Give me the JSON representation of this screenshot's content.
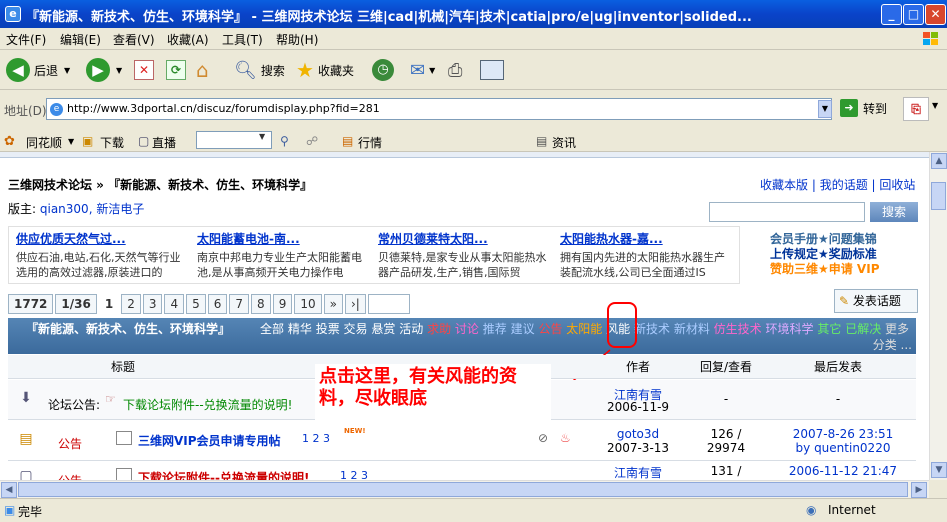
{
  "window": {
    "title": "『新能源、新技术、仿生、环境科学』 - 三维网技术论坛 三维|cad|机械|汽车|技术|catia|pro/e|ug|inventor|solided...",
    "min": "_",
    "max": "□",
    "close": "✕"
  },
  "menu": [
    "文件(F)",
    "编辑(E)",
    "查看(V)",
    "收藏(A)",
    "工具(T)",
    "帮助(H)"
  ],
  "toolbar": {
    "back": "后退",
    "search": "搜索",
    "favorites": "收藏夹"
  },
  "address": {
    "label": "地址(D)",
    "url": "http://www.3dportal.cn/discuz/forumdisplay.php?fid=281",
    "go": "转到"
  },
  "links": {
    "tonghuashun": "同花顺",
    "download": "下载",
    "broadcast": "直播",
    "market": "行情",
    "news": "资讯"
  },
  "forum": {
    "breadcrumb": "三维网技术论坛 » 『新能源、新技术、仿生、环境科学』",
    "top_links": [
      "收藏本版",
      "我的话题",
      "回收站"
    ],
    "moderator_label": "版主:",
    "moderators": "qian300, 新洁电子",
    "search_button": "搜索",
    "ads": [
      {
        "title": "供应优质天然气过...",
        "desc": "供应石油,电站,石化,天然气等行业选用的高效过滤器,原装进口的"
      },
      {
        "title": "太阳能蓄电池-南...",
        "desc": "南京中邦电力专业生产太阳能蓄电池,是从事高频开关电力操作电"
      },
      {
        "title": "常州贝德莱特太阳...",
        "desc": "贝德莱特,是家专业从事太阳能热水器产品研发,生产,销售,国际贸"
      },
      {
        "title": "太阳能热水器-嘉...",
        "desc": "拥有国内先进的太阳能热水器生产装配流水线,公司已全面通过IS"
      }
    ],
    "promo": [
      "会员手册★问题集锦",
      "上传规定★奖励标准",
      "赞助三维★申请 VIP"
    ],
    "pager": {
      "total": "1772",
      "pages": "1/36",
      "nums": [
        "1",
        "2",
        "3",
        "4",
        "5",
        "6",
        "7",
        "8",
        "9",
        "10",
        "»",
        "›|"
      ]
    },
    "post_button": "发表话题",
    "forum_title": "『新能源、新技术、仿生、环境科学』",
    "filters": [
      "全部",
      "精华",
      "投票",
      "交易",
      "悬赏",
      "活动"
    ],
    "categories": [
      {
        "label": "求助",
        "color": "#ff4444"
      },
      {
        "label": "讨论",
        "color": "#ff66cc"
      },
      {
        "label": "推荐",
        "color": "#aaccff"
      },
      {
        "label": "建议",
        "color": "#aaccff"
      },
      {
        "label": "公告",
        "color": "#ff4444"
      },
      {
        "label": "太阳能",
        "color": "#ffaa00"
      },
      {
        "label": "风能",
        "color": "#ffffff"
      },
      {
        "label": "新技术",
        "color": "#aaccff"
      },
      {
        "label": "新材料",
        "color": "#aaccff"
      },
      {
        "label": "仿生技术",
        "color": "#ff66cc"
      },
      {
        "label": "环境科学",
        "color": "#ddaaff"
      },
      {
        "label": "其它",
        "color": "#66ee66"
      },
      {
        "label": "已解决",
        "color": "#66ee66"
      },
      {
        "label": "更多",
        "color": "#dddddd"
      },
      {
        "label": "分类 ...",
        "color": "#dddddd"
      }
    ],
    "columns": {
      "title": "标题",
      "author": "作者",
      "replies": "回复/查看",
      "last": "最后发表"
    },
    "annotation": "点击这里，有关风能的资料，尽收眼底",
    "rows": [
      {
        "type": "论坛公告:",
        "title": "下载论坛附件--兑换流量的说明!",
        "author": "江南有雪",
        "date": "2006-11-9",
        "replies": "-",
        "last": "-",
        "last_by": ""
      },
      {
        "type": "公告",
        "title": "三维网VIP会员申请专用帖",
        "pages": "1 2 3",
        "author": "goto3d",
        "date": "2007-3-13",
        "replies": "126 /",
        "views": "29974",
        "last": "2007-8-26 23:51",
        "last_by": "by quentin0220"
      },
      {
        "type": "公告",
        "title": "下载论坛附件--兑换流量的说明!",
        "pages": "1 2 3",
        "author": "江南有雪",
        "date": "",
        "replies": "131 /",
        "views": "",
        "last": "2006-11-12 21:47",
        "last_by": ""
      }
    ]
  },
  "status": {
    "text": "完毕",
    "zone": "Internet"
  }
}
